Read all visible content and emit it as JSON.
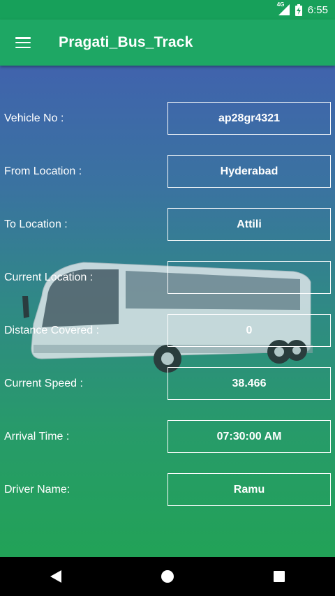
{
  "status": {
    "network": "4G",
    "time": "6:55"
  },
  "app": {
    "title": "Pragati_Bus_Track"
  },
  "fields": [
    {
      "label": "Vehicle No :",
      "value": "ap28gr4321"
    },
    {
      "label": "From Location :",
      "value": "Hyderabad"
    },
    {
      "label": "To Location :",
      "value": "Attili"
    },
    {
      "label": "Current Location :",
      "value": ""
    },
    {
      "label": "Distance Covered :",
      "value": "0"
    },
    {
      "label": "Current Speed :",
      "value": "38.466"
    },
    {
      "label": "Arrival Time :",
      "value": "07:30:00 AM"
    },
    {
      "label": "Driver Name:",
      "value": "Ramu"
    }
  ],
  "icons": {
    "menu": "hamburger-menu-icon",
    "signal": "cell-signal-icon",
    "battery": "battery-charging-icon",
    "back": "nav-back-icon",
    "home": "nav-home-icon",
    "recents": "nav-recents-icon"
  },
  "colors": {
    "app_bar": "#1ea764",
    "status_bar": "#17a05a",
    "gradient_top": "#4063ad",
    "gradient_bottom": "#22a257"
  }
}
